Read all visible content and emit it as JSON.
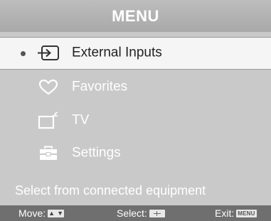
{
  "menu": {
    "title": "MENU",
    "items": [
      {
        "label": "External Inputs",
        "icon": "input-icon",
        "selected": true
      },
      {
        "label": "Favorites",
        "icon": "heart-icon",
        "selected": false
      },
      {
        "label": "TV",
        "icon": "tv-icon",
        "selected": false
      },
      {
        "label": "Settings",
        "icon": "toolbox-icon",
        "selected": false
      }
    ],
    "status": "Select from connected equipment"
  },
  "footer": {
    "move_label": "Move:",
    "select_label": "Select:",
    "exit_label": "Exit:",
    "exit_key": "MENU"
  },
  "colors": {
    "background": "#c9c9c9",
    "selected_row": "#f5f5f5",
    "footer": "#6f6f6f"
  }
}
